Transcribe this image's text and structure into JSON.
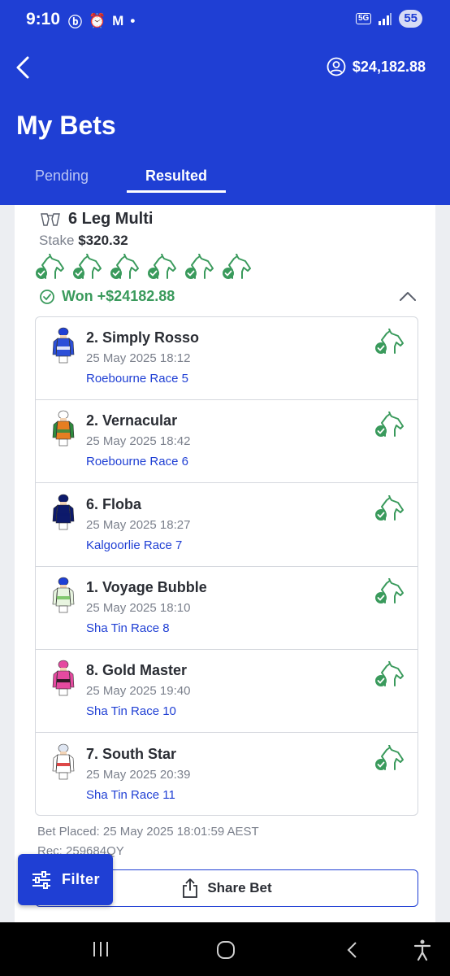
{
  "status_bar": {
    "time": "9:10",
    "left_icons": [
      "b-app-icon",
      "alarm-icon",
      "gmail-icon",
      "dot-icon"
    ],
    "network": "5G",
    "battery": "55"
  },
  "header": {
    "balance": "$24,182.88",
    "title": "My Bets",
    "tabs": [
      {
        "label": "Pending",
        "active": false
      },
      {
        "label": "Resulted",
        "active": true
      }
    ]
  },
  "bet": {
    "type": "6 Leg Multi",
    "stake_label": "Stake",
    "stake_value": "$320.32",
    "leg_count": 6,
    "result_text": "Won +$24182.88",
    "legs": [
      {
        "runner": "2. Simply Rosso",
        "time": "25 May 2025 18:12",
        "race": "Roebourne Race 5",
        "silk": "blue-white"
      },
      {
        "runner": "2. Vernacular",
        "time": "25 May 2025 18:42",
        "race": "Roebourne Race 6",
        "silk": "green-orange"
      },
      {
        "runner": "6. Floba",
        "time": "25 May 2025 18:27",
        "race": "Kalgoorlie Race 7",
        "silk": "navy"
      },
      {
        "runner": "1. Voyage Bubble",
        "time": "25 May 2025 18:10",
        "race": "Sha Tin Race 8",
        "silk": "white-green"
      },
      {
        "runner": "8. Gold Master",
        "time": "25 May 2025 19:40",
        "race": "Sha Tin Race 10",
        "silk": "pink-black"
      },
      {
        "runner": "7. South Star",
        "time": "25 May 2025 20:39",
        "race": "Sha Tin Race 11",
        "silk": "red-white"
      }
    ],
    "placed": "Bet Placed: 25 May 2025 18:01:59 AEST",
    "receipt": "Rec: 259684QY",
    "share_label": "Share Bet"
  },
  "filter_label": "Filter",
  "colors": {
    "brand_blue": "#1f3fd4",
    "win_green": "#3a9a5c"
  }
}
